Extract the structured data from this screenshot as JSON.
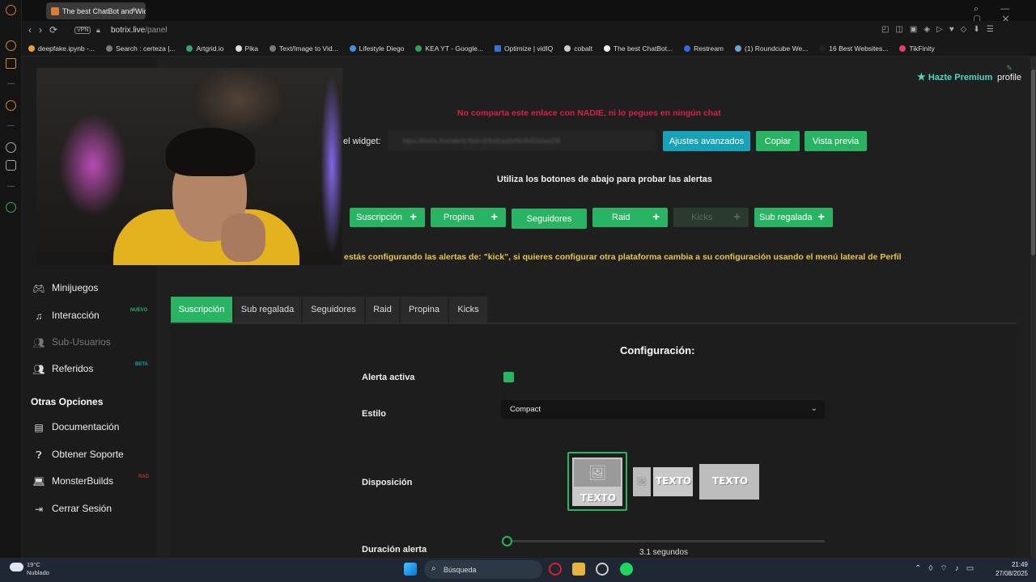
{
  "browser": {
    "tab_title": "The best ChatBot and Wid",
    "new_tab": "+",
    "vpn": "VPN",
    "url_host": "botrix.live",
    "url_path": "/panel"
  },
  "bookmarks": [
    "deepfake.ipynb -...",
    "Search : certeza |...",
    "Artgrid.io",
    "Pika",
    "Text/Image to Vid...",
    "Lifestyle Diego",
    "KEA YT - Google...",
    "Optimize | vidIQ",
    "cobalt",
    "The best ChatBot...",
    "Restream",
    "(1) Roundcube We...",
    "16 Best Websites...",
    "TikFinity"
  ],
  "header": {
    "premium": "Hazte Premium",
    "profile": "profile"
  },
  "widget": {
    "warning": "No comparta este enlace con NADIE, ni lo pegues en ningún chat",
    "label": "el widget:",
    "url_value": "https://botrix.live/alerts?bid=00bd5aa0e9b2b41b5aa2f8",
    "advanced": "Ajustes avanzados",
    "copy": "Copiar",
    "preview": "Vista previa"
  },
  "test": {
    "hint": "Utiliza los botones de abajo para probar las alertas",
    "buttons": [
      "Suscripción",
      "Propina",
      "Seguidores",
      "Raid",
      "Kicks",
      "Sub regalada"
    ],
    "plus": "+",
    "platform_msg": "estás configurando las alertas de: \"kick\", si quieres configurar otra plataforma cambia a su configuración usando el menú lateral de Perfil"
  },
  "sidebar": {
    "items": [
      {
        "label": "Minijuegos",
        "icon": "gamepad-icon"
      },
      {
        "label": "Interacción",
        "icon": "music-icon",
        "badge": "NUEVO"
      },
      {
        "label": "Sub-Usuarios",
        "icon": "users-icon"
      },
      {
        "label": "Referidos",
        "icon": "users-icon",
        "badge": "BETA"
      }
    ],
    "section": "Otras Opciones",
    "other": [
      {
        "label": "Documentación",
        "icon": "book-icon"
      },
      {
        "label": "Obtener Soporte",
        "icon": "question-icon"
      },
      {
        "label": "MonsterBuilds",
        "icon": "laptop-icon",
        "badge": "RAD"
      },
      {
        "label": "Cerrar Sesión",
        "icon": "logout-icon"
      }
    ]
  },
  "config": {
    "tabs": [
      "Suscripción",
      "Sub regalada",
      "Seguidores",
      "Raid",
      "Propina",
      "Kicks"
    ],
    "active_tab": "Suscripción",
    "title": "Configuración:",
    "alert_active": "Alerta activa",
    "style_label": "Estilo",
    "style_value": "Compact",
    "layout_label": "Disposición",
    "layout_text": "TEXTO",
    "duration_label": "Duración alerta",
    "duration_value": "3.1 segundos"
  },
  "taskbar": {
    "temp": "19°C",
    "weather": "Nublado",
    "search": "Búsqueda",
    "time": "21:49",
    "date": "27/08/2025"
  },
  "colors": {
    "green": "#28b463",
    "teal": "#17a2b8",
    "warning_red": "#d6214a",
    "platform_yellow": "#e9c641"
  }
}
